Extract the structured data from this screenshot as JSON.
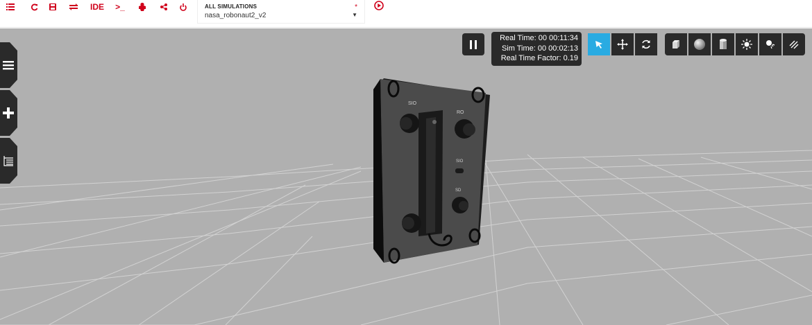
{
  "toolbar": {
    "icons": [
      "list-icon",
      "refresh-icon",
      "save-icon",
      "swap-icon",
      "ide-label",
      "terminal-icon",
      "robot-icon",
      "share-icon",
      "power-icon"
    ],
    "ide_label": "IDE",
    "terminal_label": ">_",
    "accent_color": "#d0021b"
  },
  "simulation": {
    "label": "ALL SIMULATIONS",
    "required_mark": "*",
    "selected": "nasa_robonaut2_v2"
  },
  "stats": {
    "real_time": "Real Time: 00 00:11:34",
    "sim_time": "Sim Time: 00 00:02:13",
    "real_time_factor": "Real Time Factor: 0.19"
  },
  "view_tools": {
    "active_color": "#29abe2",
    "tools": [
      "select-icon",
      "translate-icon",
      "rotate-icon"
    ],
    "shapes": [
      "box-icon",
      "sphere-icon",
      "cylinder-icon",
      "point-light-icon",
      "spot-light-icon",
      "directional-light-icon"
    ]
  },
  "side_tabs": [
    "menu-icon",
    "insert-icon",
    "tree-icon"
  ],
  "panel_labels": {
    "top_left": "SIO",
    "top_right": "RO",
    "middle": "SIO",
    "lower": "SD"
  }
}
